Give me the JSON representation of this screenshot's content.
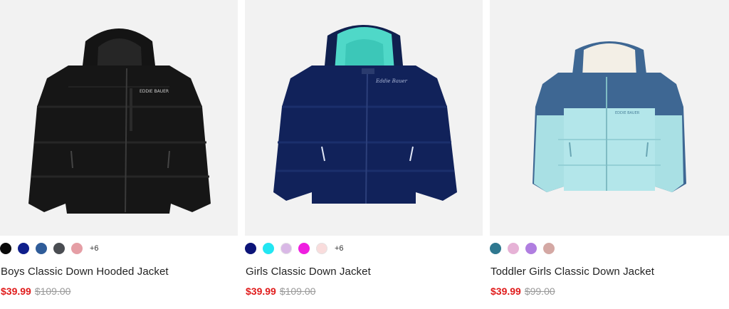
{
  "products": [
    {
      "title": "Boys Classic Down Hooded Jacket",
      "sale_price": "$39.99",
      "original_price": "$109.00",
      "more_colors": "+6",
      "swatches": [
        "#0a0a0a",
        "#0f1f8c",
        "#2f5c99",
        "#4a4d52",
        "#e59ea5"
      ]
    },
    {
      "title": "Girls Classic Down Jacket",
      "sale_price": "$39.99",
      "original_price": "$109.00",
      "more_colors": "+6",
      "swatches": [
        "#0c1478",
        "#22e6f2",
        "#d9b8e6",
        "#ef1ee0",
        "#f9dcdc"
      ]
    },
    {
      "title": "Toddler Girls Classic Down Jacket",
      "sale_price": "$39.99",
      "original_price": "$99.00",
      "more_colors": "",
      "swatches": [
        "#2f7890",
        "#e6b2d6",
        "#b07ee0",
        "#d4a8a4"
      ]
    }
  ]
}
